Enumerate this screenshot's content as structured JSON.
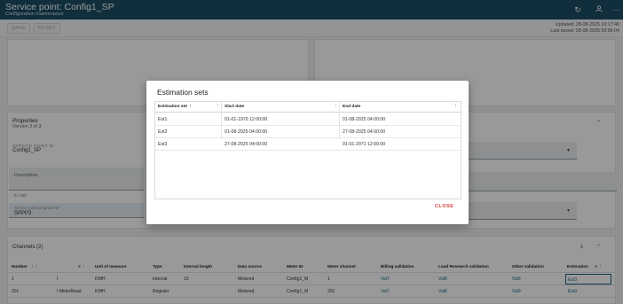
{
  "header": {
    "title": "Service point: Config1_SP",
    "subtitle": "Configuration maintenance"
  },
  "toolbar": {
    "save_label": "SAVE",
    "reset_label": "RESET",
    "updated": "Updated: 28-08-2025 10:17:40",
    "last_saved": "Last saved: 28-08-2025 09:56:04"
  },
  "properties": {
    "title": "Properties",
    "version": "Version 3 of 3",
    "service_point_id_label": "SERVICE POINT ID",
    "service_point_id_value": "Config1_SP",
    "description_label": "Description",
    "description_counter": "0 / 100",
    "program_label": "Service point program ID*",
    "program_value": "SPPP3"
  },
  "channels": {
    "title": "Channels (2)",
    "columns": [
      "Number",
      "Unit of measure",
      "Type",
      "Interval length",
      "Data source",
      "Meter ID",
      "Meter channel",
      "Billing validation",
      "Load Research validation",
      "Other validation",
      "Estimation"
    ],
    "rows": [
      {
        "number": "1",
        "name": "I",
        "unit": "KWH",
        "type": "Interval",
        "interval": "15",
        "source": "Metered",
        "meter": "Config1_M",
        "channel": "1",
        "billing": "Val7",
        "load": "Val8",
        "other": "Val9",
        "estimation": "Est3"
      },
      {
        "number": "201",
        "name": "I MeterRead",
        "unit": "KWH",
        "type": "Register",
        "interval": "",
        "source": "Metered",
        "meter": "Config1_M",
        "channel": "201",
        "billing": "Val7",
        "load": "Val8",
        "other": "Val9",
        "estimation": "Est3"
      }
    ]
  },
  "dialog": {
    "title": "Estimation sets",
    "columns": {
      "set": "Estimation set",
      "start": "Start date",
      "end": "End date"
    },
    "rows": [
      {
        "set": "Est1",
        "start": "01-01-1970 12:00:00",
        "end": "01-08-2025 04:00:00"
      },
      {
        "set": "Est2",
        "start": "01-08-2025 04:00:00",
        "end": "27-08-2025 04:00:00"
      },
      {
        "set": "Est3",
        "start": "27-08-2025 04:00:00",
        "end": "01-01-2071 12:00:00"
      }
    ],
    "close_label": "CLOSE"
  },
  "icons": {
    "refresh": "refresh-icon",
    "account": "account-icon",
    "more": "more-icon",
    "sort_up": "arrow-up-icon",
    "column_menu": "more-vertical-icon",
    "filter": "filter-icon",
    "download": "download-icon",
    "collapse": "chevron-up-icon",
    "dropdown": "chevron-down-icon"
  },
  "colors": {
    "header_bg": "#1b4d63",
    "link": "#1b6a8a",
    "close": "#d0413b"
  }
}
